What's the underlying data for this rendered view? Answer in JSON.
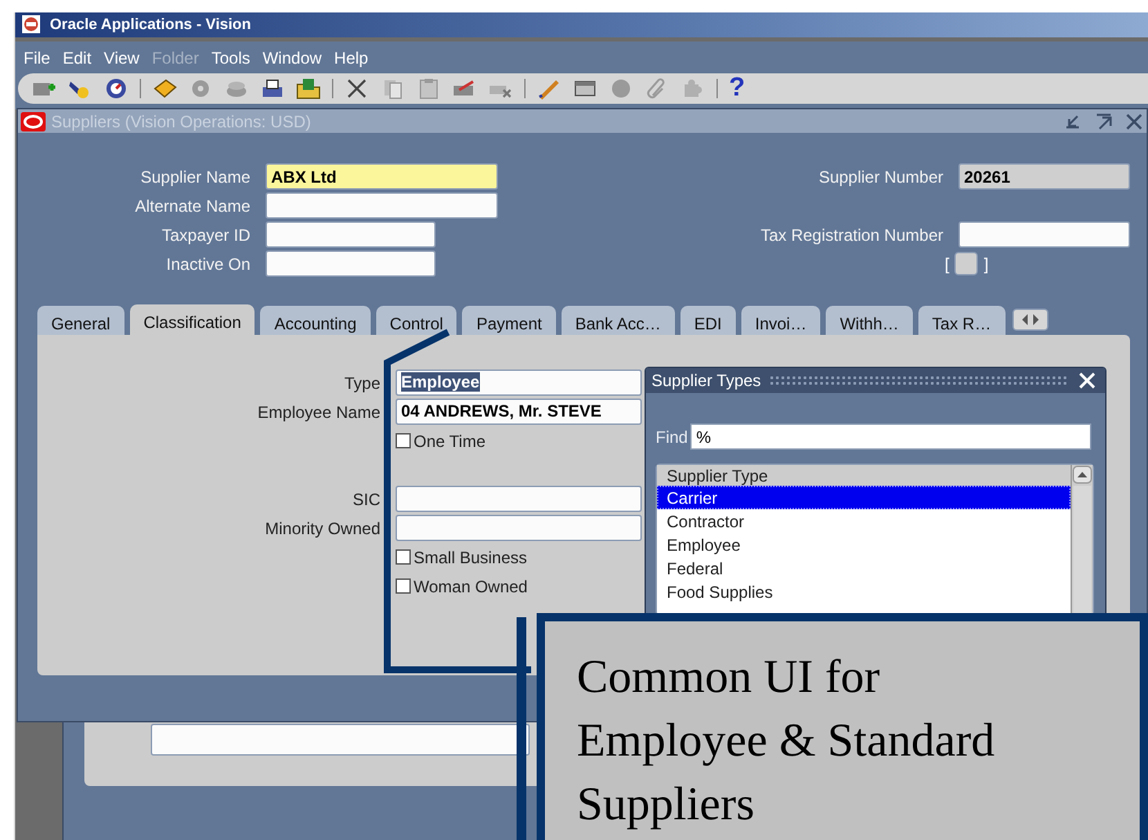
{
  "app": {
    "title": "Oracle Applications - Vision"
  },
  "menu": [
    {
      "label": "File",
      "disabled": false
    },
    {
      "label": "Edit",
      "disabled": false
    },
    {
      "label": "View",
      "disabled": false
    },
    {
      "label": "Folder",
      "disabled": true
    },
    {
      "label": "Tools",
      "disabled": false
    },
    {
      "label": "Window",
      "disabled": false
    },
    {
      "label": "Help",
      "disabled": false
    }
  ],
  "toolbar": {
    "help": "?"
  },
  "window": {
    "title": "Suppliers (Vision Operations: USD)"
  },
  "header": {
    "fields": [
      {
        "label": "Supplier Name",
        "value": "ABX Ltd",
        "kind": "required"
      },
      {
        "label": "Alternate Name",
        "kind": "wide"
      },
      {
        "label": "Taxpayer ID",
        "kind": "short"
      },
      {
        "label": "Inactive On",
        "kind": "short"
      }
    ],
    "right_fields": [
      {
        "label": "Supplier Number",
        "value": "20261",
        "kind": "readonly"
      },
      {
        "label": "Tax Registration Number",
        "kind": "wide"
      }
    ],
    "flex_field": {
      "open": "[",
      "close": "]"
    }
  },
  "tabs": [
    {
      "label": "General",
      "selected": false
    },
    {
      "label": "Classification",
      "selected": true
    },
    {
      "label": "Accounting",
      "selected": false
    },
    {
      "label": "Control",
      "selected": false
    },
    {
      "label": "Payment",
      "selected": false
    },
    {
      "label": "Bank Acc…",
      "selected": false
    },
    {
      "label": "EDI",
      "selected": false
    },
    {
      "label": "Invoi…",
      "selected": false
    },
    {
      "label": "Withh…",
      "selected": false
    },
    {
      "label": "Tax R…",
      "selected": false
    }
  ],
  "classification": {
    "fields": [
      {
        "kind": "text",
        "label": "Type",
        "value": "Employee",
        "highlighted": true
      },
      {
        "kind": "text",
        "label": "Employee Name",
        "value": "04 ANDREWS, Mr. STEVE",
        "highlighted": false
      },
      {
        "kind": "checkbox",
        "label": "One Time",
        "checked": false
      },
      {
        "kind": "gap"
      },
      {
        "kind": "text",
        "label": "SIC"
      },
      {
        "kind": "text",
        "label": "Minority Owned"
      },
      {
        "kind": "checkbox",
        "label": "Small Business",
        "checked": false
      },
      {
        "kind": "checkbox",
        "label": "Woman Owned",
        "checked": false
      }
    ]
  },
  "dialog": {
    "title": "Supplier Types",
    "find_label": "Find",
    "find_value": "%",
    "column": "Supplier Type",
    "rows": [
      {
        "label": "Carrier",
        "selected": true
      },
      {
        "label": "Contractor",
        "selected": false
      },
      {
        "label": "Employee",
        "selected": false
      },
      {
        "label": "Federal",
        "selected": false
      },
      {
        "label": "Food Supplies",
        "selected": false
      }
    ]
  },
  "callout": {
    "text": "Common UI for Employee & Standard Suppliers"
  }
}
